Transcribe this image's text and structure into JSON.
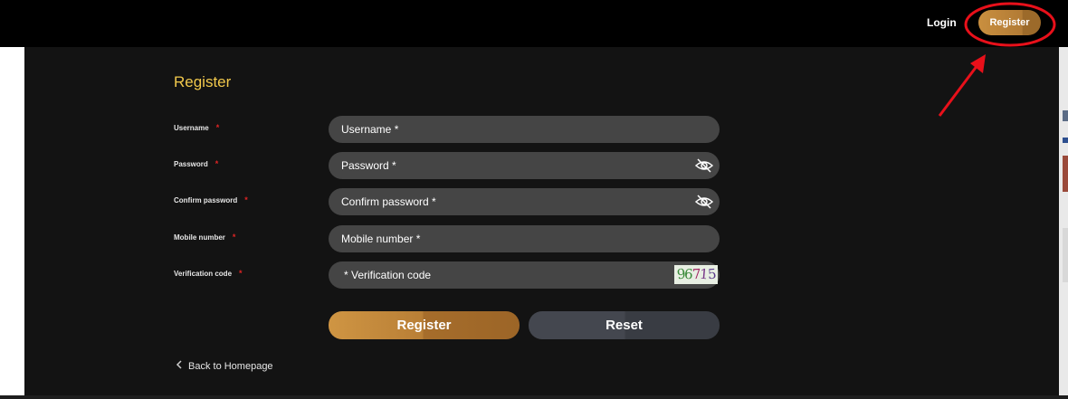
{
  "header": {
    "login_label": "Login",
    "register_label": "Register"
  },
  "form": {
    "title": "Register",
    "required_mark": "*",
    "fields": [
      {
        "label": "Username",
        "placeholder": "Username *"
      },
      {
        "label": "Password",
        "placeholder": "Password *",
        "icon": "eye-off-icon"
      },
      {
        "label": "Confirm password",
        "placeholder": "Confirm password *",
        "icon": "eye-off-icon"
      },
      {
        "label": "Mobile number",
        "placeholder": "Mobile number *"
      },
      {
        "label": "Verification code",
        "placeholder": "* Verification code"
      }
    ],
    "captcha": {
      "chars": [
        "9",
        "6",
        "7",
        "1",
        "5"
      ],
      "colors": [
        "#3a8a3a",
        "#3a8a3a",
        "#a02060",
        "#7a3a8a",
        "#5a3a8a"
      ]
    },
    "register_label": "Register",
    "reset_label": "Reset",
    "back_label": "Back to Homepage"
  },
  "colors": {
    "accent_gold": "#f2c94c",
    "required_red": "#e02424",
    "annotation_red": "#e8101a"
  }
}
